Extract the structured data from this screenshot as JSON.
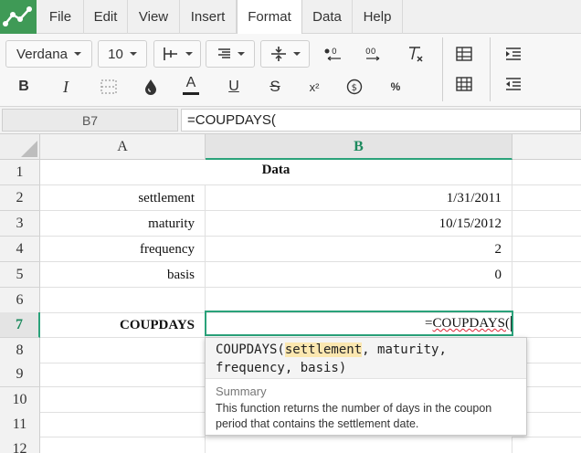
{
  "menu": {
    "items": [
      {
        "label": "File"
      },
      {
        "label": "Edit"
      },
      {
        "label": "View"
      },
      {
        "label": "Insert"
      },
      {
        "label": "Format"
      },
      {
        "label": "Data"
      },
      {
        "label": "Help"
      }
    ],
    "active": "Format"
  },
  "toolbar": {
    "font_family": "Verdana",
    "font_size": "10",
    "icons_row1": [
      "borders-icon",
      "align-icon",
      "valign-icon",
      "decrease-decimal-icon",
      "increase-decimal-icon",
      "clear-format-icon"
    ],
    "icons_row2": [
      "bold-icon",
      "italic-icon",
      "merge-cells-icon",
      "fill-color-icon",
      "text-color-icon",
      "underline-icon",
      "strikethrough-icon",
      "superscript-icon",
      "currency-icon",
      "percent-icon"
    ],
    "bold_label": "B",
    "italic_label": "I",
    "text_color_label": "A",
    "underline_label": "U",
    "strike_label": "S",
    "superscript_label": "x²",
    "percent_label": "%",
    "accent_color": "#3f9a56"
  },
  "formula_bar": {
    "cell_ref": "B7",
    "formula": "=COUPDAYS("
  },
  "grid": {
    "columns": [
      "A",
      "B"
    ],
    "selected_column": "B",
    "rows": [
      "1",
      "2",
      "3",
      "4",
      "5",
      "6",
      "7",
      "8",
      "9",
      "10",
      "11",
      "12"
    ],
    "selected_row": "7",
    "header": "Data",
    "labels": [
      "settlement",
      "maturity",
      "frequency",
      "basis"
    ],
    "values": [
      "1/31/2011",
      "10/15/2012",
      "2",
      "0"
    ],
    "result_label": "COUPDAYS",
    "active_prefix": "=",
    "active_func": "COUPDAYS("
  },
  "tooltip": {
    "sig_func": "COUPDAYS(",
    "sig_current_arg": "settlement",
    "sig_rest_line1": ", maturity,",
    "sig_line2": "frequency, basis)",
    "summary_title": "Summary",
    "summary_text": "This function returns the number of days in the coupon period that contains the settlement date."
  }
}
